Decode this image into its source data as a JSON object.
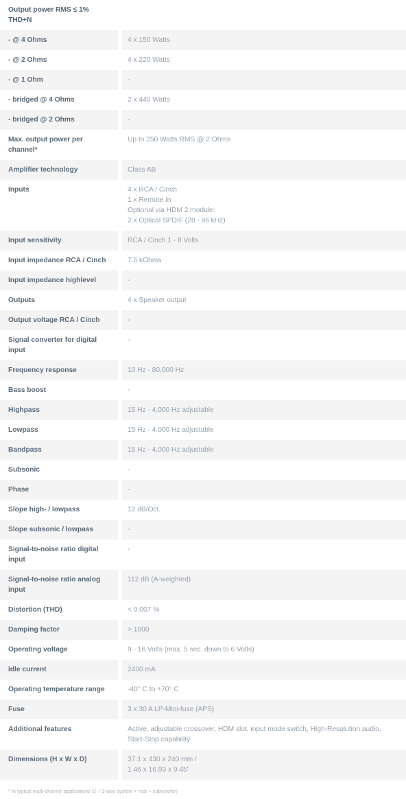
{
  "table": {
    "rows": [
      {
        "label": "Output power RMS  ≤ 1% THD+N",
        "value_lines": [],
        "shaded": false,
        "header": true
      },
      {
        "label": "- @ 4 Ohms",
        "value_lines": [
          "4 x 150 Watts"
        ],
        "shaded": true,
        "header": false
      },
      {
        "label": "- @ 2 Ohms",
        "value_lines": [
          "4 x 220 Watts"
        ],
        "shaded": false,
        "header": false
      },
      {
        "label": "- @ 1 Ohm",
        "value_lines": [
          "-"
        ],
        "shaded": true,
        "header": false
      },
      {
        "label": "- bridged @ 4 Ohms",
        "value_lines": [
          "2 x 440 Watts"
        ],
        "shaded": false,
        "header": false
      },
      {
        "label": "- bridged @ 2 Ohms",
        "value_lines": [
          "-"
        ],
        "shaded": true,
        "header": false
      },
      {
        "label": "Max. output power per channel*",
        "value_lines": [
          "Up to 250 Watts RMS @ 2 Ohms"
        ],
        "shaded": false,
        "header": false
      },
      {
        "label": "Amplifier technology",
        "value_lines": [
          "Class AB"
        ],
        "shaded": true,
        "header": false
      },
      {
        "label": "Inputs",
        "value_lines": [
          "4 x RCA / Cinch",
          "1 x Remote In",
          "Optional via HDM 2 module:",
          "2 x Optical SPDIF (28 - 96 kHz)"
        ],
        "shaded": false,
        "header": false
      },
      {
        "label": "Input sensitivity",
        "value_lines": [
          "RCA / Cinch 1 - 8 Volts"
        ],
        "shaded": true,
        "header": false
      },
      {
        "label": "Input impedance RCA / Cinch",
        "value_lines": [
          "7.5 kOhms"
        ],
        "shaded": false,
        "header": false
      },
      {
        "label": "Input impedance highlevel",
        "value_lines": [
          "-"
        ],
        "shaded": true,
        "header": false
      },
      {
        "label": "Outputs",
        "value_lines": [
          "4 x Speaker output"
        ],
        "shaded": false,
        "header": false
      },
      {
        "label": "Output voltage RCA / Cinch",
        "value_lines": [
          "-"
        ],
        "shaded": true,
        "header": false
      },
      {
        "label": "Signal converter for digital input",
        "value_lines": [
          "-"
        ],
        "shaded": false,
        "header": false
      },
      {
        "label": "Frequency response",
        "value_lines": [
          "10 Hz - 80,000 Hz"
        ],
        "shaded": true,
        "header": false
      },
      {
        "label": "Bass boost",
        "value_lines": [
          "-"
        ],
        "shaded": false,
        "header": false
      },
      {
        "label": "Highpass",
        "value_lines": [
          "15 Hz - 4,000 Hz adjustable"
        ],
        "shaded": true,
        "header": false
      },
      {
        "label": "Lowpass",
        "value_lines": [
          "15 Hz - 4,000 Hz adjustable"
        ],
        "shaded": false,
        "header": false
      },
      {
        "label": "Bandpass",
        "value_lines": [
          "15 Hz - 4,000 Hz adjustable"
        ],
        "shaded": true,
        "header": false
      },
      {
        "label": "Subsonic",
        "value_lines": [
          "-"
        ],
        "shaded": false,
        "header": false
      },
      {
        "label": "Phase",
        "value_lines": [
          "-"
        ],
        "shaded": true,
        "header": false
      },
      {
        "label": "Slope high- / lowpass",
        "value_lines": [
          "12 dB/Oct."
        ],
        "shaded": false,
        "header": false
      },
      {
        "label": "Slope subsonic / lowpass",
        "value_lines": [
          "-"
        ],
        "shaded": true,
        "header": false
      },
      {
        "label": "Signal-to-noise ratio digital input",
        "value_lines": [
          "-"
        ],
        "shaded": false,
        "header": false
      },
      {
        "label": "Signal-to-noise ratio analog input",
        "value_lines": [
          "112 dB (A-weighted)"
        ],
        "shaded": true,
        "header": false
      },
      {
        "label": "Distortion (THD)",
        "value_lines": [
          "< 0.007 %"
        ],
        "shaded": false,
        "header": false
      },
      {
        "label": "Damping factor",
        "value_lines": [
          "> 1000"
        ],
        "shaded": true,
        "header": false
      },
      {
        "label": "Operating voltage",
        "value_lines": [
          "9 - 16 Volts  (max. 5 sec. down to 6 Volts)"
        ],
        "shaded": false,
        "header": false
      },
      {
        "label": "Idle current",
        "value_lines": [
          "2400 mA"
        ],
        "shaded": true,
        "header": false
      },
      {
        "label": "Operating temperature range",
        "value_lines": [
          "-40° C to +70° C"
        ],
        "shaded": false,
        "header": false
      },
      {
        "label": "Fuse",
        "value_lines": [
          "3 x 30 A LP-Mini-fuse (APS)"
        ],
        "shaded": true,
        "header": false
      },
      {
        "label": "Additional features",
        "value_lines": [
          "Active, adjustable crossover, HDM slot, input mode switch, High-Resolution audio, Start-Stop capability"
        ],
        "shaded": false,
        "header": false
      },
      {
        "label": "Dimensions (H x W x D)",
        "value_lines": [
          "37.1 x 430 x 240 mm /",
          "1.46 x 16.93 x 9.45”"
        ],
        "shaded": true,
        "header": false
      }
    ]
  },
  "footnote": "* In typical multi-channel applications (2- / 3-way system + rear + subwoofer)",
  "colors": {
    "row_shaded": "#f4f4f5",
    "row_plain": "#ffffff",
    "label_text": "#5b6a78",
    "value_text": "#97a1ab",
    "footnote_text": "#aab3bc"
  }
}
